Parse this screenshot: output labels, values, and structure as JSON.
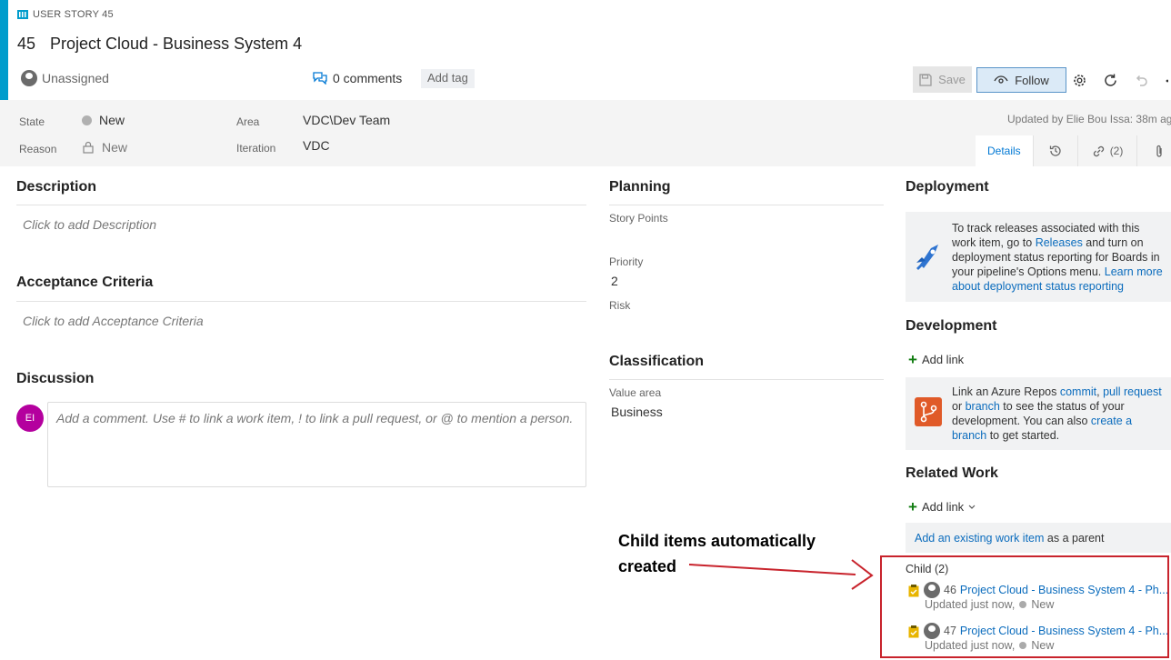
{
  "header": {
    "type_label": "USER STORY 45",
    "id": "45",
    "title": "Project Cloud - Business System 4",
    "assignee": "Unassigned",
    "comments": "0 comments",
    "add_tag": "Add tag",
    "save_label": "Save",
    "follow_label": "Follow"
  },
  "fields": {
    "state_label": "State",
    "state_value": "New",
    "reason_label": "Reason",
    "reason_value": "New",
    "area_label": "Area",
    "area_value": "VDC\\Dev Team",
    "iteration_label": "Iteration",
    "iteration_value": "VDC",
    "updated_by": "Updated by Elie Bou Issa: 38m ag"
  },
  "tabs": {
    "details": "Details",
    "links_count": "(2)"
  },
  "description": {
    "title": "Description",
    "placeholder": "Click to add Description"
  },
  "acceptance": {
    "title": "Acceptance Criteria",
    "placeholder": "Click to add Acceptance Criteria"
  },
  "discussion": {
    "title": "Discussion",
    "avatar_initials": "EI",
    "placeholder": "Add a comment. Use # to link a work item, ! to link a pull request, or @ to mention a person."
  },
  "planning": {
    "title": "Planning",
    "story_points_label": "Story Points",
    "priority_label": "Priority",
    "priority_value": "2",
    "risk_label": "Risk"
  },
  "classification": {
    "title": "Classification",
    "value_area_label": "Value area",
    "value_area_value": "Business"
  },
  "deployment": {
    "title": "Deployment",
    "text_1": "To track releases associated with this work item, go to ",
    "releases_link": "Releases",
    "text_2": " and turn on deployment status reporting for Boards in your pipeline's Options menu. ",
    "learn_link": "Learn more about deployment status reporting"
  },
  "development": {
    "title": "Development",
    "add_link": "Add link",
    "text_1": "Link an Azure Repos ",
    "commit_link": "commit",
    "comma": ", ",
    "pr_link": "pull request",
    "text_2": " or ",
    "branch_link": "branch",
    "text_3": " to see the status of your development. You can also ",
    "create_branch_link": "create a branch",
    "text_4": " to get started."
  },
  "related_work": {
    "title": "Related Work",
    "add_link": "Add link",
    "existing_link": "Add an existing work item",
    "existing_suffix": " as a parent",
    "child_header": "Child (2)",
    "children": [
      {
        "id": "46",
        "title": "Project Cloud - Business System 4 - Ph...",
        "updated": "Updated just now,",
        "state": "New"
      },
      {
        "id": "47",
        "title": "Project Cloud - Business System 4 - Ph...",
        "updated": "Updated just now,",
        "state": "New"
      }
    ]
  },
  "annotation": {
    "line_1": "Child items automatically",
    "line_2": "created"
  },
  "colors": {
    "accent": "#009ccc",
    "link": "#0b6cbd",
    "annotation_red": "#c8232c",
    "avatar_purple": "#b4009e"
  }
}
